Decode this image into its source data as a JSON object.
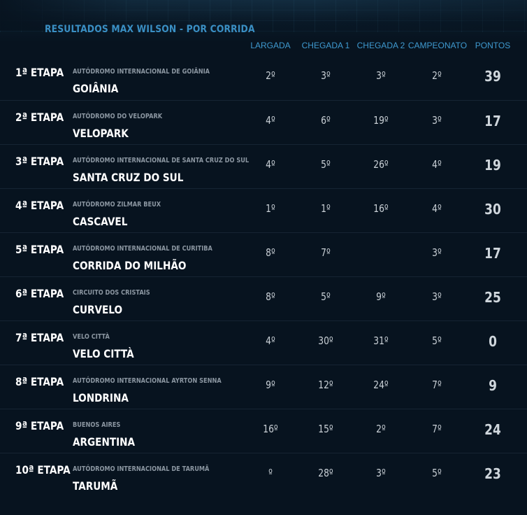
{
  "title": "RESULTADOS MAX WILSON - POR CORRIDA",
  "columns": {
    "largada": "LARGADA",
    "chegada1": "CHEGADA 1",
    "chegada2": "CHEGADA 2",
    "campeonato": "CAMPEONATO",
    "pontos": "PONTOS"
  },
  "rows": [
    {
      "stage": "1ª ETAPA",
      "track": "AUTÓDROMO INTERNACIONAL DE GOIÂNIA",
      "city": "GOIÂNIA",
      "largada": "2º",
      "chegada1": "3º",
      "chegada2": "3º",
      "campeonato": "2º",
      "pontos": "39"
    },
    {
      "stage": "2ª ETAPA",
      "track": "AUTÓDROMO DO VELOPARK",
      "city": "VELOPARK",
      "largada": "4º",
      "chegada1": "6º",
      "chegada2": "19º",
      "campeonato": "3º",
      "pontos": "17"
    },
    {
      "stage": "3ª ETAPA",
      "track": "AUTÓDROMO INTERNACIONAL DE SANTA CRUZ DO SUL",
      "city": "SANTA CRUZ DO SUL",
      "largada": "4º",
      "chegada1": "5º",
      "chegada2": "26º",
      "campeonato": "4º",
      "pontos": "19"
    },
    {
      "stage": "4ª ETAPA",
      "track": "AUTÓDROMO ZILMAR BEUX",
      "city": "CASCAVEL",
      "largada": "1º",
      "chegada1": "1º",
      "chegada2": "16º",
      "campeonato": "4º",
      "pontos": "30"
    },
    {
      "stage": "5ª ETAPA",
      "track": "AUTÓDROMO INTERNACIONAL DE CURITIBA",
      "city": "CORRIDA DO MILHÃO",
      "largada": "8º",
      "chegada1": "7º",
      "chegada2": "",
      "campeonato": "3º",
      "pontos": "17"
    },
    {
      "stage": "6ª ETAPA",
      "track": "CIRCUITO DOS CRISTAIS",
      "city": "CURVELO",
      "largada": "8º",
      "chegada1": "5º",
      "chegada2": "9º",
      "campeonato": "3º",
      "pontos": "25"
    },
    {
      "stage": "7ª ETAPA",
      "track": "VELO CITTÀ",
      "city": "VELO CITTÀ",
      "largada": "4º",
      "chegada1": "30º",
      "chegada2": "31º",
      "campeonato": "5º",
      "pontos": "0"
    },
    {
      "stage": "8ª ETAPA",
      "track": "AUTÓDROMO INTERNACIONAL AYRTON SENNA",
      "city": "LONDRINA",
      "largada": "9º",
      "chegada1": "12º",
      "chegada2": "24º",
      "campeonato": "7º",
      "pontos": "9"
    },
    {
      "stage": "9ª ETAPA",
      "track": "BUENOS AIRES",
      "city": "ARGENTINA",
      "largada": "16º",
      "chegada1": "15º",
      "chegada2": "2º",
      "campeonato": "7º",
      "pontos": "24"
    },
    {
      "stage": "10ª ETAPA",
      "track": "AUTÓDROMO INTERNACIONAL DE TARUMÃ",
      "city": "TARUMÃ",
      "largada": "º",
      "chegada1": "28º",
      "chegada2": "3º",
      "campeonato": "5º",
      "pontos": "23"
    }
  ]
}
